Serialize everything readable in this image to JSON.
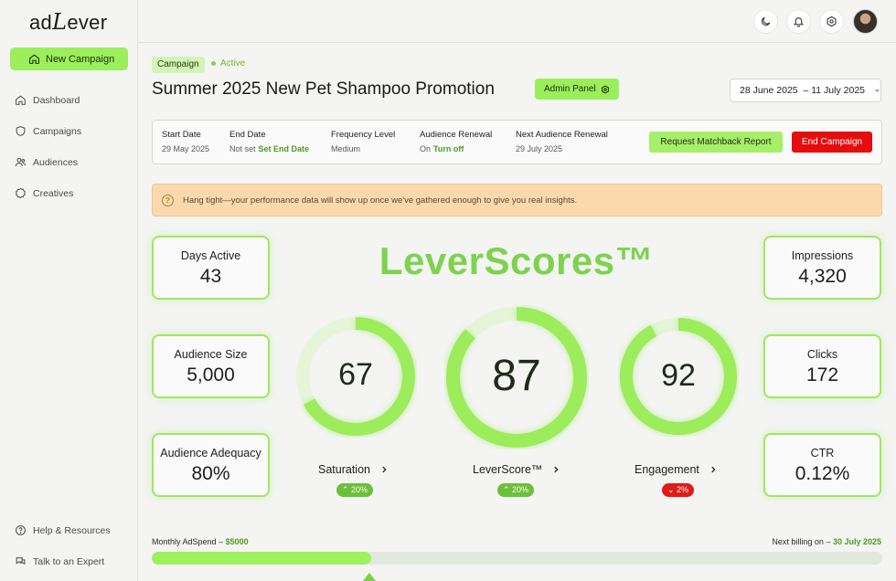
{
  "app": {
    "logo_prefix": "ad",
    "logo_letter": "L",
    "logo_suffix": "ever"
  },
  "sidebar": {
    "new_campaign": "New Campaign",
    "items": [
      {
        "label": "Dashboard",
        "icon": "home-icon"
      },
      {
        "label": "Campaigns",
        "icon": "shield-icon"
      },
      {
        "label": "Audiences",
        "icon": "users-icon"
      },
      {
        "label": "Creatives",
        "icon": "creatives-icon"
      }
    ],
    "bottom": [
      {
        "label": "Help & Resources",
        "icon": "help-icon"
      },
      {
        "label": "Talk to an Expert",
        "icon": "chat-icon"
      }
    ]
  },
  "topbar": {
    "icons": [
      "moon-icon",
      "bell-icon",
      "settings-icon"
    ]
  },
  "campaign": {
    "tag": "Campaign",
    "status": "Active",
    "title": "Summer 2025 New Pet Shampoo Promotion",
    "admin_panel": "Admin Panel",
    "date_range": "28 June 2025  – 11 July 2025"
  },
  "info": {
    "start_label": "Start Date",
    "start_value": "29 May 2025",
    "end_label": "End Date",
    "end_value": "Not set",
    "end_link": "Set End Date",
    "freq_label": "Frequency Level",
    "freq_value": "Medium",
    "renewal_label": "Audience Renewal",
    "renewal_value": "On",
    "renewal_link": "Turn off",
    "next_label": "Next Audience Renewal",
    "next_value": "29 July 2025",
    "request_btn": "Request Matchback Report",
    "end_btn": "End Campaign"
  },
  "notice": {
    "text": "Hang tight—your performance data will show up once we've gathered enough to give you real insights."
  },
  "stats_left": [
    {
      "label": "Days Active",
      "value": "43"
    },
    {
      "label": "Audience Size",
      "value": "5,000"
    },
    {
      "label": "Audience Adequacy",
      "value": "80%"
    }
  ],
  "stats_right": [
    {
      "label": "Impressions",
      "value": "4,320"
    },
    {
      "label": "Clicks",
      "value": "172"
    },
    {
      "label": "CTR",
      "value": "0.12%"
    }
  ],
  "leverscores": {
    "title": "LeverScores™",
    "gauges": [
      {
        "label": "Saturation",
        "value": "67",
        "fraction": 0.67,
        "change": "20%",
        "trend": "up"
      },
      {
        "label": "LeverScore™",
        "value": "87",
        "fraction": 0.87,
        "change": "20%",
        "trend": "up"
      },
      {
        "label": "Engagement",
        "value": "92",
        "fraction": 0.92,
        "change": "2%",
        "trend": "down"
      }
    ]
  },
  "spend": {
    "label": "Monthly AdSpend – ",
    "amount": "$5000",
    "billing_label": "Next billing on – ",
    "billing_date": "30 July 2025",
    "progress": 0.3
  },
  "colors": {
    "accent": "#9aef5a",
    "accent_dark": "#7ed34e",
    "danger": "#e50d0d",
    "notice_bg": "#fbd9ad"
  }
}
